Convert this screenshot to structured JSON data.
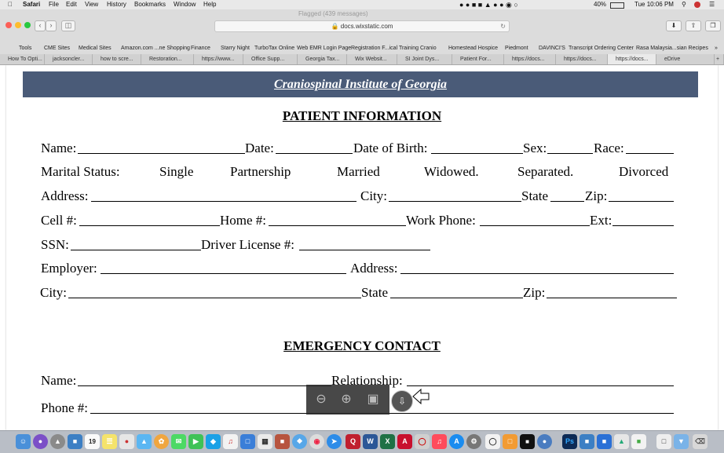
{
  "menubar": {
    "apple": "",
    "items": [
      "Safari",
      "File",
      "Edit",
      "View",
      "History",
      "Bookmarks",
      "Window",
      "Help"
    ],
    "battery": "40%",
    "clock": "Tue 10:06 PM"
  },
  "window": {
    "ghost_title": "Flagged (439 messages)",
    "url": "docs.wixstatic.com"
  },
  "bookmarks": [
    "Tools",
    "CME Sites",
    "Medical Sites",
    "Amazon.com ...ne Shopping",
    "Finance",
    "Starry Night",
    "TurboTax Online",
    "Web EMR Login Page",
    "Registration F...ical Training",
    "Cranio",
    "Homestead Hospice",
    "Piedmont",
    "DAVINCI'S",
    "Transcript Ordering Center",
    "Rasa Malaysia...sian Recipes"
  ],
  "tabs": [
    "How To Opti...",
    "jacksoncler...",
    "how to scre...",
    "Restoration...",
    "https://www...",
    "Office Supp...",
    "Georgia Tax...",
    "Wix Websit...",
    "SI Joint Dys...",
    "Patient For...",
    "https://docs...",
    "https://docs...",
    "https://docs...",
    "eDrive"
  ],
  "form": {
    "banner": "Craniospinal Institute of Georgia",
    "heading": "PATIENT INFORMATION",
    "name": "Name:",
    "date": "Date:",
    "dob": "Date of Birth:",
    "sex": "Sex:",
    "race": "Race:",
    "marital": "Marital Status:",
    "single": "Single",
    "partnership": "Partnership",
    "married": "Married",
    "widowed": "Widowed.",
    "separated": "Separated.",
    "divorced": "Divorced",
    "address": "Address:",
    "city": "City:",
    "state": "State",
    "zip": "Zip:",
    "cell": "Cell #:",
    "home": "Home #:",
    "work": "Work Phone:",
    "ext": "Ext:",
    "ssn": "SSN:",
    "license": "Driver License #:",
    "employer": "Employer:",
    "emp_address": "Address:",
    "emp_city": "City:",
    "emp_state": "State",
    "emp_zip": "Zip:",
    "emergency": "EMERGENCY CONTACT",
    "ec_name": "Name:",
    "ec_relationship": "Relationship:",
    "ec_phone": "Phone #:"
  },
  "dock": {
    "calendar_day": "19"
  }
}
